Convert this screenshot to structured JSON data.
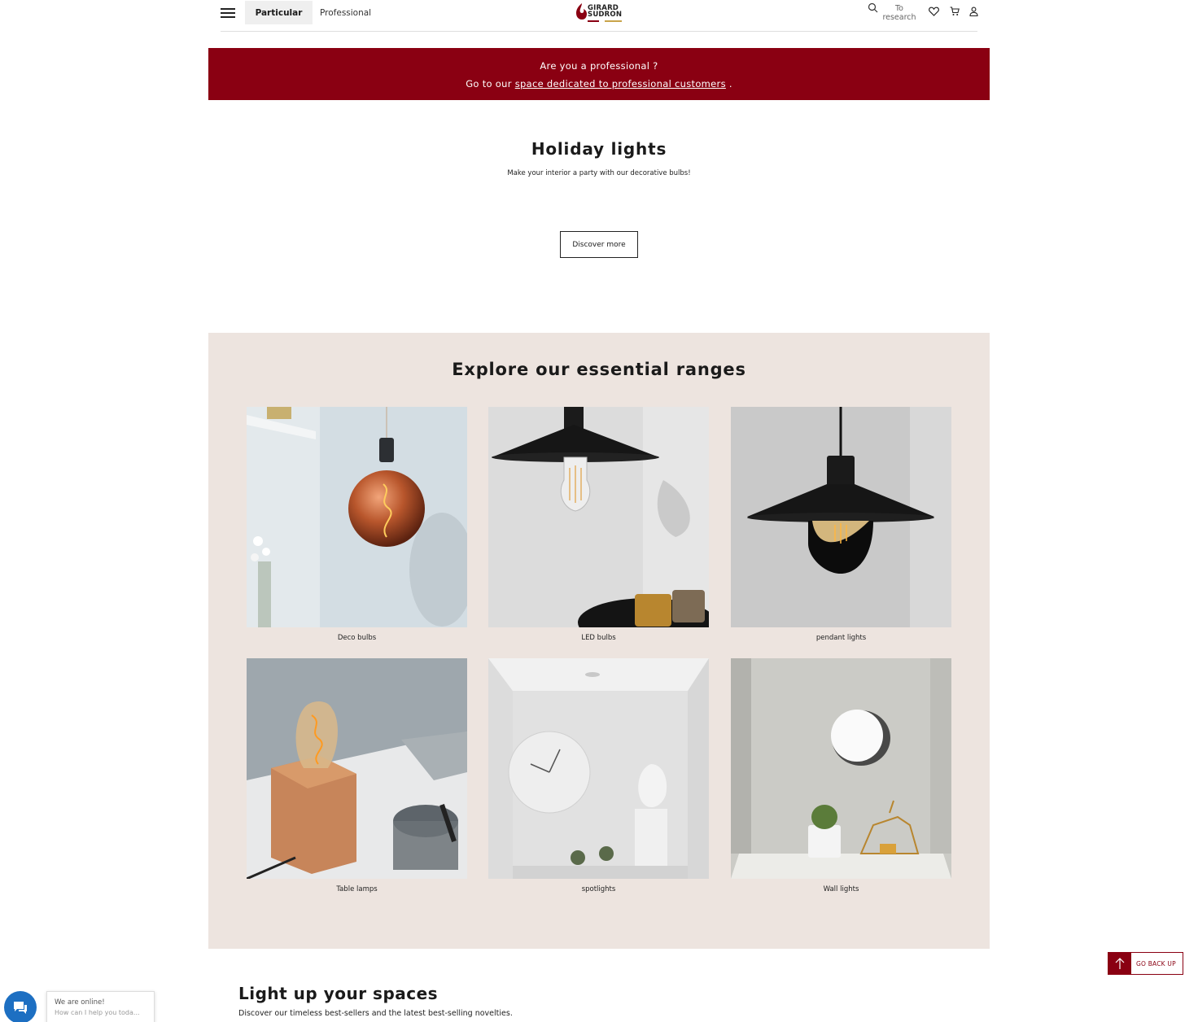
{
  "header": {
    "tab_particular": "Particular",
    "tab_professional": "Professional",
    "logo_line1": "GIRARD",
    "logo_line2": "SUDRON",
    "search_label": "To research",
    "icons": [
      "hamburger-menu-icon",
      "search-icon",
      "heart-icon",
      "cart-icon",
      "user-icon"
    ]
  },
  "banner": {
    "line1": "Are you a professional ?",
    "line2_prefix": "Go to our",
    "line2_link": "space dedicated to professional customers",
    "line2_suffix": ".",
    "background": "#8a0012"
  },
  "holiday": {
    "title": "Holiday lights",
    "subtitle": "Make your interior a party with our decorative bulbs!",
    "button": "Discover more"
  },
  "ranges": {
    "title": "Explore our essential ranges",
    "background": "#ede4df",
    "items": [
      {
        "label": "Deco bulbs"
      },
      {
        "label": "LED bulbs"
      },
      {
        "label": "pendant lights"
      },
      {
        "label": "Table lamps"
      },
      {
        "label": "spotlights"
      },
      {
        "label": "Wall lights"
      }
    ]
  },
  "lightup": {
    "title": "Light up your spaces",
    "subtitle": "Discover our timeless best-sellers and the latest best-selling novelties."
  },
  "back_up": {
    "label": "GO BACK UP",
    "icon": "arrow-up-icon"
  },
  "chat": {
    "status": "We are online!",
    "prompt": "How can I help you toda...",
    "icon": "chat-icon"
  }
}
